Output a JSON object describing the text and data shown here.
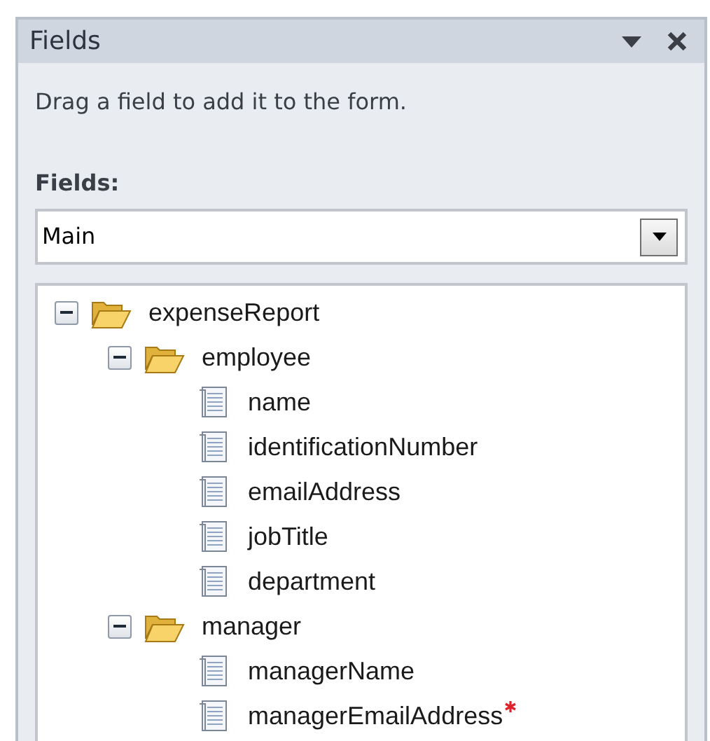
{
  "panel": {
    "title": "Fields",
    "instruction": "Drag a field to add it to the form."
  },
  "fields_label": "Fields:",
  "dropdown": {
    "value": "Main"
  },
  "tree": [
    {
      "label": "expenseReport",
      "kind": "group",
      "expanded": true,
      "children": [
        {
          "label": "employee",
          "kind": "group",
          "expanded": true,
          "children": [
            {
              "label": "name",
              "kind": "field",
              "required": false
            },
            {
              "label": "identificationNumber",
              "kind": "field",
              "required": false
            },
            {
              "label": "emailAddress",
              "kind": "field",
              "required": false
            },
            {
              "label": "jobTitle",
              "kind": "field",
              "required": false
            },
            {
              "label": "department",
              "kind": "field",
              "required": false
            }
          ]
        },
        {
          "label": "manager",
          "kind": "group",
          "expanded": true,
          "children": [
            {
              "label": "managerName",
              "kind": "field",
              "required": false
            },
            {
              "label": "managerEmailAddress",
              "kind": "field",
              "required": true
            }
          ]
        }
      ]
    }
  ]
}
